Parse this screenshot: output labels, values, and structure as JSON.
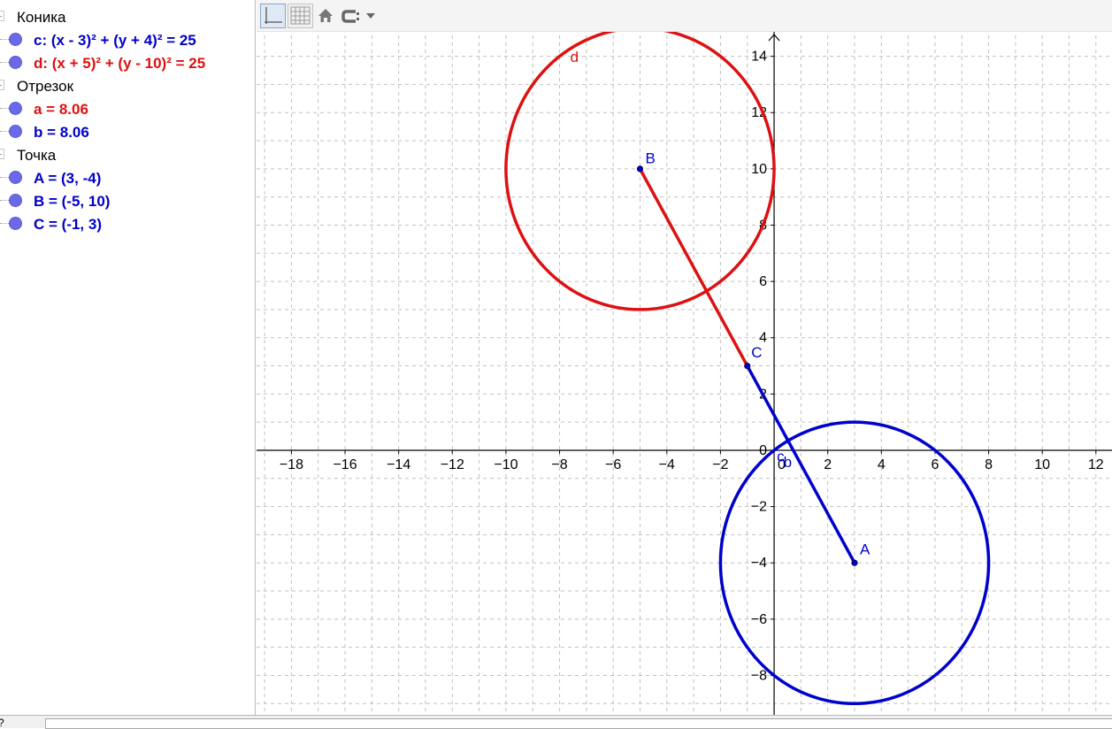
{
  "algebra": {
    "groups": [
      {
        "label": "Коника",
        "items": [
          {
            "text": "c: (x - 3)² + (y + 4)² = 25",
            "color": "#0000cc"
          },
          {
            "text": "d: (x + 5)² + (y - 10)² = 25",
            "color": "#dd1111"
          }
        ]
      },
      {
        "label": "Отрезок",
        "items": [
          {
            "text": "a = 8.06",
            "color": "#dd1111"
          },
          {
            "text": "b = 8.06",
            "color": "#0000cc"
          }
        ]
      },
      {
        "label": "Точка",
        "items": [
          {
            "text": "A = (3, -4)",
            "color": "#0000cc"
          },
          {
            "text": "B = (-5, 10)",
            "color": "#0000cc"
          },
          {
            "text": "C = (-1, 3)",
            "color": "#0000cc"
          }
        ]
      }
    ]
  },
  "toolbar": {
    "icons": [
      "axes-toggle-icon",
      "grid-toggle-icon",
      "home-icon",
      "line-style-icon",
      "chevron-down-icon"
    ]
  },
  "input_bar": {
    "help_label": "?"
  },
  "chart_data": {
    "type": "scatter",
    "xlim": [
      -19.3,
      12.6
    ],
    "ylim": [
      -9.4,
      16
    ],
    "grid": true,
    "x_ticks": [
      -18,
      -16,
      -14,
      -12,
      -10,
      -8,
      -6,
      -4,
      -2,
      0,
      2,
      4,
      6,
      8,
      10,
      12
    ],
    "y_ticks": [
      -8,
      -6,
      -4,
      -2,
      0,
      2,
      4,
      6,
      8,
      10,
      12,
      14
    ],
    "objects": {
      "circles": [
        {
          "name": "c",
          "center": [
            3,
            -4
          ],
          "radius": 5,
          "color": "#0000cc",
          "label": "",
          "label_at": [
            3,
            -4
          ]
        },
        {
          "name": "d",
          "center": [
            -5,
            10
          ],
          "radius": 5,
          "color": "#dd1111",
          "label": "d",
          "label_at": [
            -7.6,
            13.8
          ]
        }
      ],
      "segments": [
        {
          "name": "a",
          "from": [
            -5,
            10
          ],
          "to": [
            -1,
            3
          ],
          "color": "#dd1111",
          "label": "",
          "label_at": [
            0,
            0
          ]
        },
        {
          "name": "b",
          "from": [
            -1,
            3
          ],
          "to": [
            3,
            -4
          ],
          "color": "#0000cc",
          "label": "b",
          "label_at": [
            0.35,
            -0.6
          ]
        }
      ],
      "points": [
        {
          "name": "A",
          "x": 3,
          "y": -4,
          "color": "#0000cc",
          "label": "A",
          "label_at": [
            3.2,
            -3.7
          ]
        },
        {
          "name": "B",
          "x": -5,
          "y": 10,
          "color": "#0000cc",
          "label": "B",
          "label_at": [
            -4.8,
            10.2
          ]
        },
        {
          "name": "C",
          "x": -1,
          "y": 3,
          "color": "#0000cc",
          "label": "C",
          "label_at": [
            -0.85,
            3.3
          ]
        }
      ],
      "extra_labels": [
        {
          "text": "c",
          "at": [
            0.1,
            -0.4
          ],
          "color": "#0000cc"
        }
      ]
    }
  }
}
